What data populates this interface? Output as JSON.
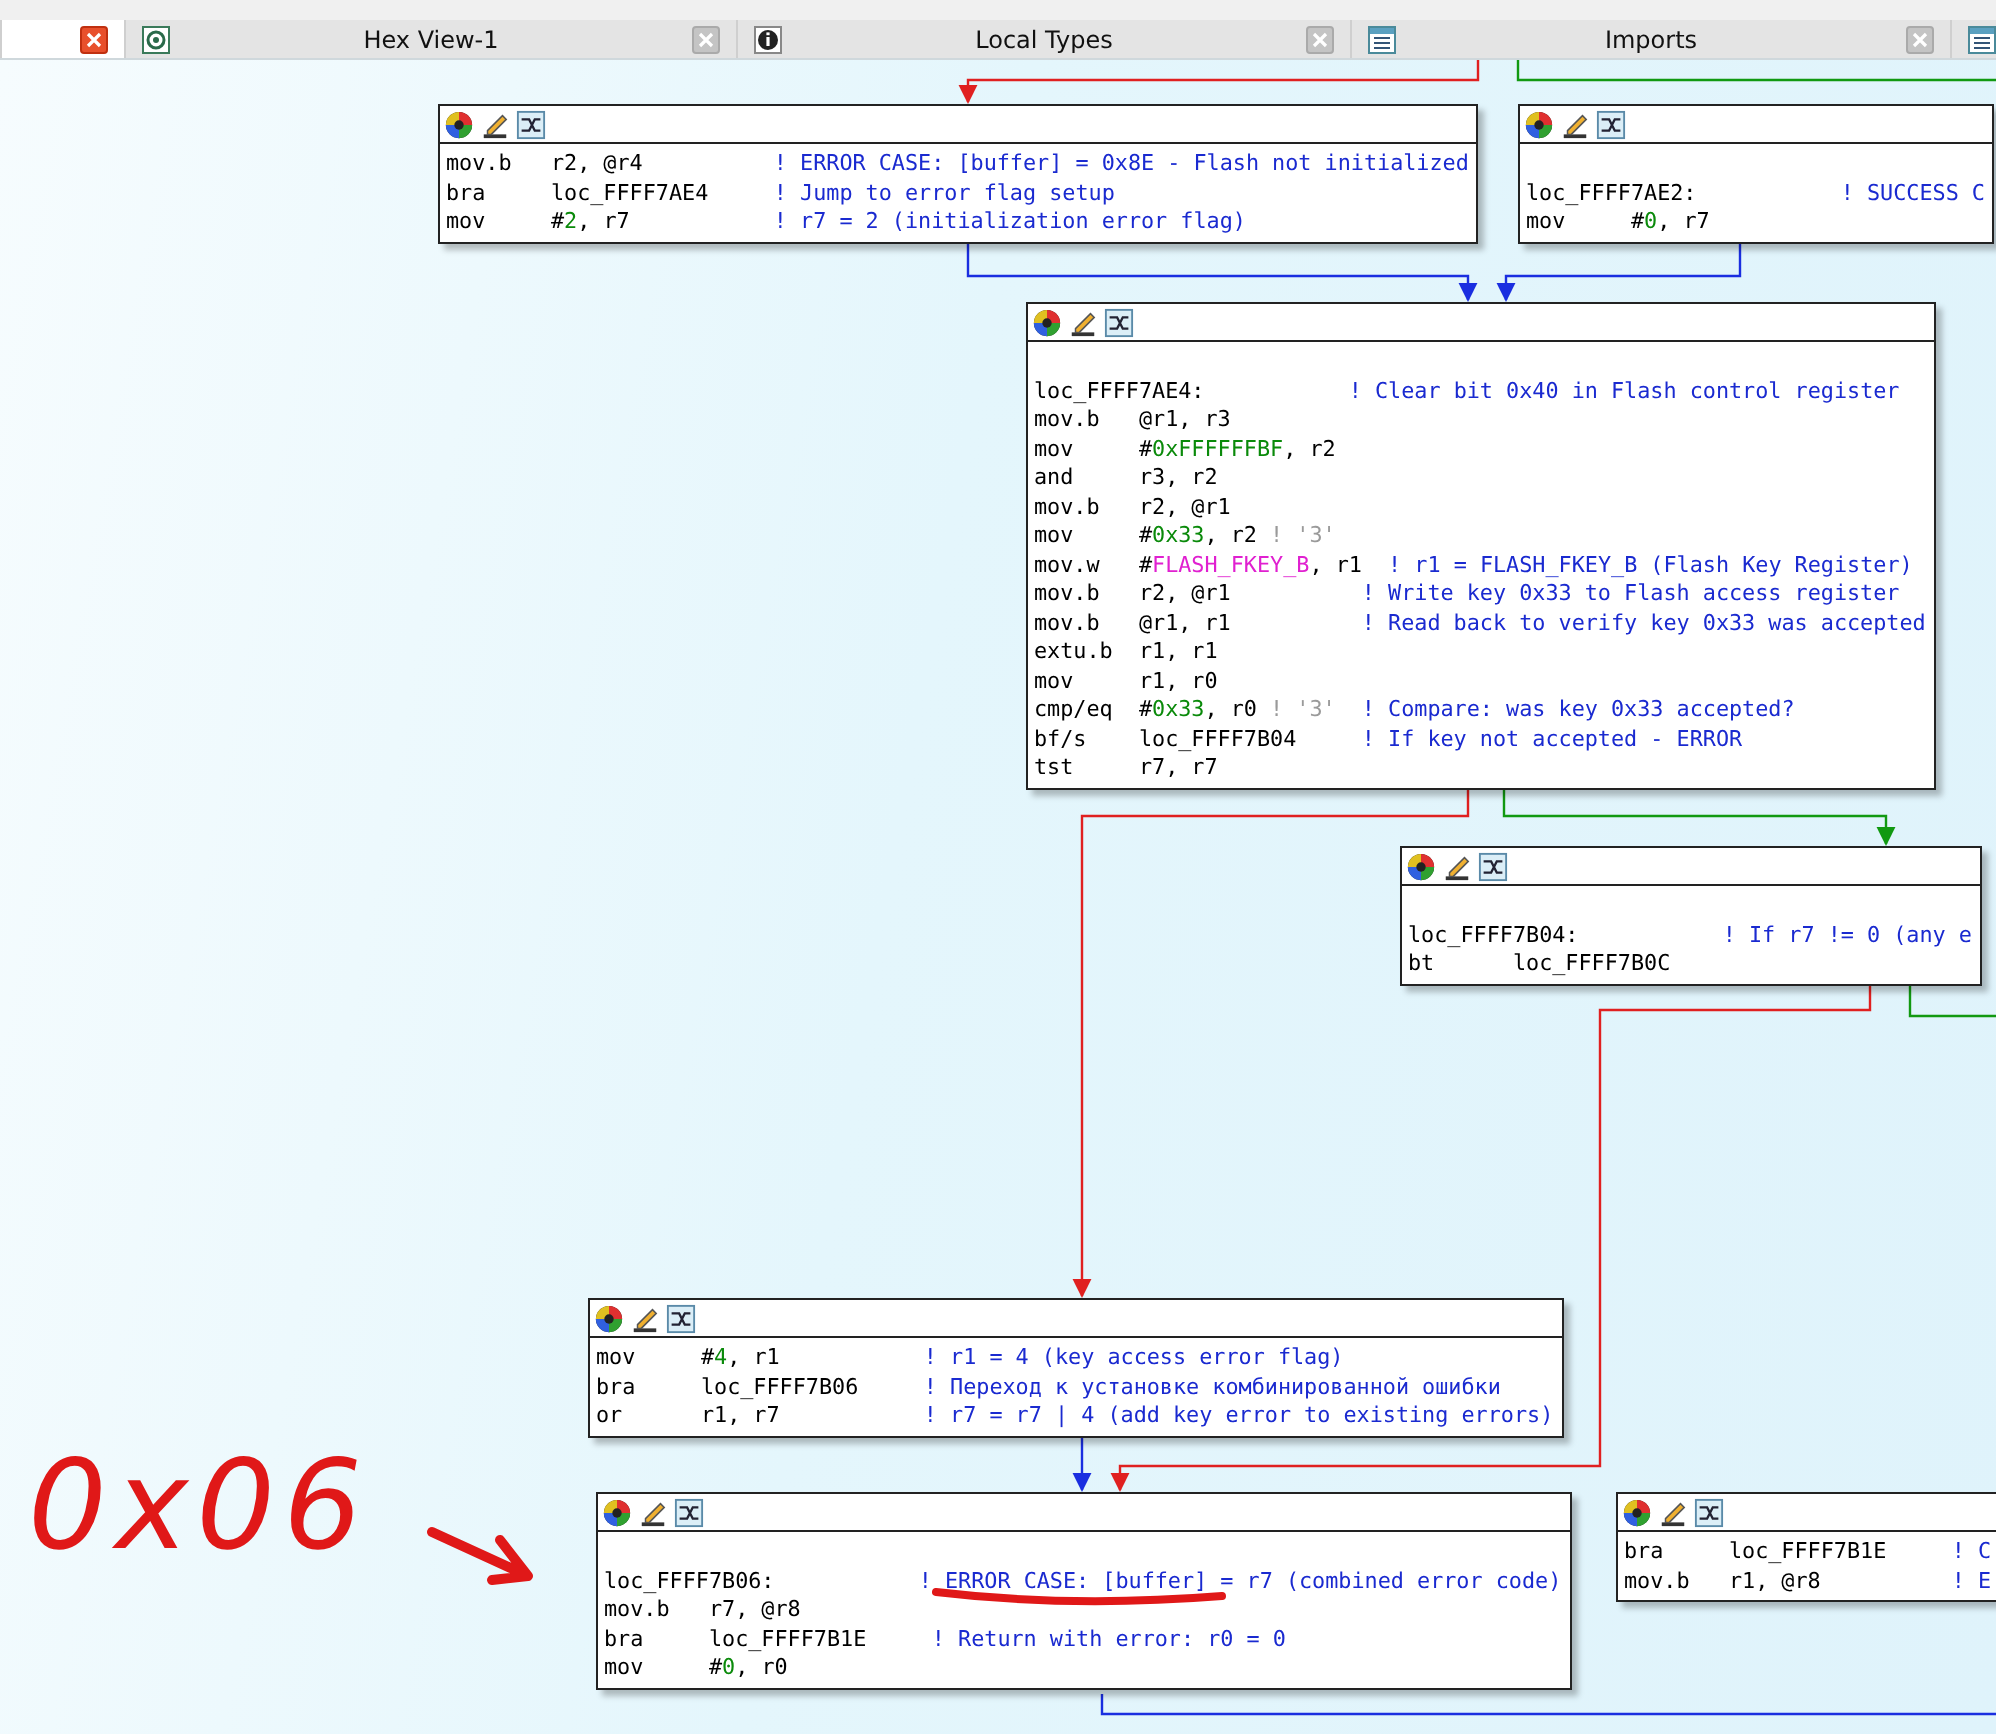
{
  "tabs": [
    {
      "kind": "plain",
      "selected": true
    },
    {
      "label": "Hex View-1",
      "kind": "hex",
      "selected": false
    },
    {
      "label": "Local Types",
      "kind": "info",
      "selected": false
    },
    {
      "label": "Imports",
      "kind": "list",
      "selected": false
    },
    {
      "kind": "list",
      "selected": false
    }
  ],
  "graph": {
    "nodes": [
      {
        "lines": [
          {
            "kind": "instruction",
            "mnemonic": "mov.b",
            "operands": [
              {
                "text": "r2, @r4",
                "kind": "plain"
              }
            ],
            "comment": "! ERROR CASE: [buffer] = 0x8E - Flash not initialized"
          },
          {
            "kind": "instruction",
            "mnemonic": "bra",
            "operands": [
              {
                "text": "loc_FFFF7AE4",
                "kind": "plain"
              }
            ],
            "comment": "! Jump to error flag setup"
          },
          {
            "kind": "instruction",
            "mnemonic": "mov",
            "operands": [
              {
                "text": "#",
                "kind": "plain"
              },
              {
                "text": "2",
                "kind": "number"
              },
              {
                "text": ", r7",
                "kind": "plain"
              }
            ],
            "comment": "! r7 = 2 (initialization error flag)"
          }
        ]
      },
      {
        "lines": [
          {
            "kind": "label",
            "label": "loc_FFFF7AE2:",
            "comment": "! SUCCESS C"
          },
          {
            "kind": "instruction",
            "mnemonic": "mov",
            "operands": [
              {
                "text": "#",
                "kind": "plain"
              },
              {
                "text": "0",
                "kind": "number"
              },
              {
                "text": ", r7",
                "kind": "plain"
              }
            ]
          }
        ]
      },
      {
        "lines": [
          {
            "kind": "label",
            "label": "loc_FFFF7AE4:",
            "comment": "! Clear bit 0x40 in Flash control register"
          },
          {
            "kind": "instruction",
            "mnemonic": "mov.b",
            "operands": [
              {
                "text": "@r1, r3",
                "kind": "plain"
              }
            ]
          },
          {
            "kind": "instruction",
            "mnemonic": "mov",
            "operands": [
              {
                "text": "#",
                "kind": "plain"
              },
              {
                "text": "0xFFFFFFBF",
                "kind": "number"
              },
              {
                "text": ", r2",
                "kind": "plain"
              }
            ]
          },
          {
            "kind": "instruction",
            "mnemonic": "and",
            "operands": [
              {
                "text": "r3, r2",
                "kind": "plain"
              }
            ]
          },
          {
            "kind": "instruction",
            "mnemonic": "mov.b",
            "operands": [
              {
                "text": "r2, @r1",
                "kind": "plain"
              }
            ]
          },
          {
            "kind": "instruction",
            "mnemonic": "mov",
            "operands": [
              {
                "text": "#",
                "kind": "plain"
              },
              {
                "text": "0x33",
                "kind": "number"
              },
              {
                "text": ", r2 ",
                "kind": "plain"
              },
              {
                "text": "! '3'",
                "kind": "autocomment"
              }
            ]
          },
          {
            "kind": "instruction",
            "mnemonic": "mov.w",
            "operands": [
              {
                "text": "#",
                "kind": "plain"
              },
              {
                "text": "FLASH_FKEY_B",
                "kind": "symbol"
              },
              {
                "text": ", r1 ",
                "kind": "plain"
              }
            ],
            "comment": "! r1 = FLASH_FKEY_B (Flash Key Register)"
          },
          {
            "kind": "instruction",
            "mnemonic": "mov.b",
            "operands": [
              {
                "text": "r2, @r1",
                "kind": "plain"
              }
            ],
            "comment": "! Write key 0x33 to Flash access register"
          },
          {
            "kind": "instruction",
            "mnemonic": "mov.b",
            "operands": [
              {
                "text": "@r1, r1",
                "kind": "plain"
              }
            ],
            "comment": "! Read back to verify key 0x33 was accepted"
          },
          {
            "kind": "instruction",
            "mnemonic": "extu.b",
            "operands": [
              {
                "text": "r1, r1",
                "kind": "plain"
              }
            ]
          },
          {
            "kind": "instruction",
            "mnemonic": "mov",
            "operands": [
              {
                "text": "r1, r0",
                "kind": "plain"
              }
            ]
          },
          {
            "kind": "instruction",
            "mnemonic": "cmp/eq",
            "operands": [
              {
                "text": "#",
                "kind": "plain"
              },
              {
                "text": "0x33",
                "kind": "number"
              },
              {
                "text": ", r0 ",
                "kind": "plain"
              },
              {
                "text": "! '3'",
                "kind": "autocomment"
              }
            ],
            "comment": "! Compare: was key 0x33 accepted?"
          },
          {
            "kind": "instruction",
            "mnemonic": "bf/s",
            "operands": [
              {
                "text": "loc_FFFF7B04",
                "kind": "plain"
              }
            ],
            "comment": "! If key not accepted - ERROR"
          },
          {
            "kind": "instruction",
            "mnemonic": "tst",
            "operands": [
              {
                "text": "r7, r7",
                "kind": "plain"
              }
            ]
          }
        ]
      },
      {
        "lines": [
          {
            "kind": "label",
            "label": "loc_FFFF7B04:",
            "comment": "! If r7 != 0 (any e"
          },
          {
            "kind": "instruction",
            "mnemonic": "bt",
            "operands": [
              {
                "text": "loc_FFFF7B0C",
                "kind": "plain"
              }
            ]
          }
        ]
      },
      {
        "lines": [
          {
            "kind": "instruction",
            "mnemonic": "mov",
            "operands": [
              {
                "text": "#",
                "kind": "plain"
              },
              {
                "text": "4",
                "kind": "number"
              },
              {
                "text": ", r1",
                "kind": "plain"
              }
            ],
            "comment": "! r1 = 4 (key access error flag)"
          },
          {
            "kind": "instruction",
            "mnemonic": "bra",
            "operands": [
              {
                "text": "loc_FFFF7B06",
                "kind": "plain"
              }
            ],
            "comment": "! Переход к установке комбинированной ошибки"
          },
          {
            "kind": "instruction",
            "mnemonic": "or",
            "operands": [
              {
                "text": "r1, r7",
                "kind": "plain"
              }
            ],
            "comment": "! r7 = r7 | 4 (add key error to existing errors)"
          }
        ]
      },
      {
        "lines": [
          {
            "kind": "label",
            "label": "loc_FFFF7B06:",
            "comment": "! ERROR CASE: [buffer] = r7 (combined error code)"
          },
          {
            "kind": "instruction",
            "mnemonic": "mov.b",
            "operands": [
              {
                "text": "r7, @r8",
                "kind": "plain"
              }
            ]
          },
          {
            "kind": "instruction",
            "mnemonic": "bra",
            "operands": [
              {
                "text": "loc_FFFF7B1E",
                "kind": "plain"
              }
            ],
            "comment": "! Return with error: r0 = 0"
          },
          {
            "kind": "instruction",
            "mnemonic": "mov",
            "operands": [
              {
                "text": "#",
                "kind": "plain"
              },
              {
                "text": "0",
                "kind": "number"
              },
              {
                "text": ", r0",
                "kind": "plain"
              }
            ]
          }
        ]
      },
      {
        "lines": [
          {
            "kind": "instruction",
            "mnemonic": "bra",
            "operands": [
              {
                "text": "loc_FFFF7B1E",
                "kind": "plain"
              }
            ],
            "comment": "! C"
          },
          {
            "kind": "instruction",
            "mnemonic": "mov.b",
            "operands": [
              {
                "text": "r1, @r8",
                "kind": "plain"
              }
            ],
            "comment": "! E"
          }
        ]
      }
    ]
  },
  "annotation": {
    "text": "0x06"
  }
}
